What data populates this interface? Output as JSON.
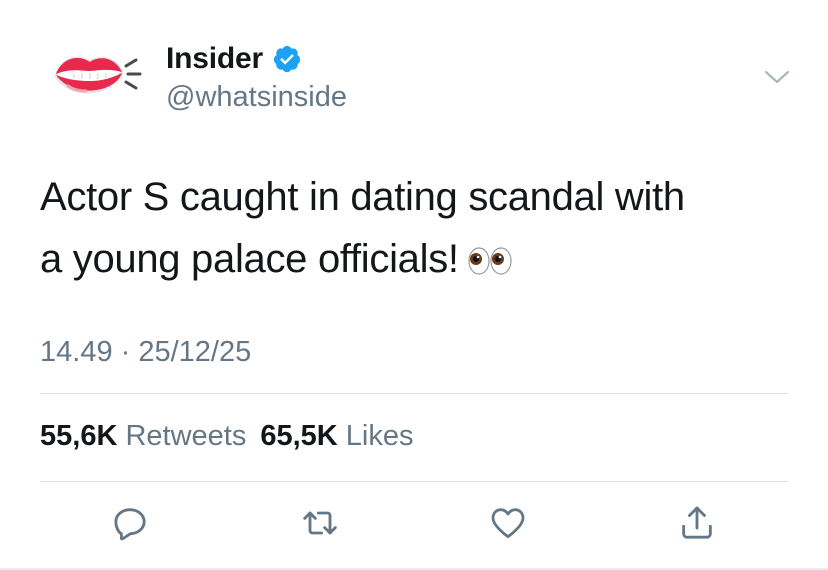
{
  "account": {
    "name": "Insider",
    "handle": "@whatsinside",
    "verified_icon": "verified-badge-icon",
    "avatar_icon": "lips-logo-icon"
  },
  "tweet": {
    "line1": "Actor S caught in dating scandal with",
    "line2": "a young palace officials!",
    "emoji_icon": "eyes-emoji-icon",
    "timestamp": "14.49 · 25/12/25"
  },
  "stats": {
    "retweets_count": "55,6K",
    "retweets_label": "Retweets",
    "likes_count": "65,5K",
    "likes_label": "Likes"
  },
  "actions": [
    "reply-icon",
    "retweet-icon",
    "like-icon",
    "share-icon"
  ],
  "colors": {
    "text": "#14171a",
    "secondary": "#657786",
    "verified": "#1da1f2",
    "action_icon": "#657786",
    "logo_red": "#e8294c"
  }
}
